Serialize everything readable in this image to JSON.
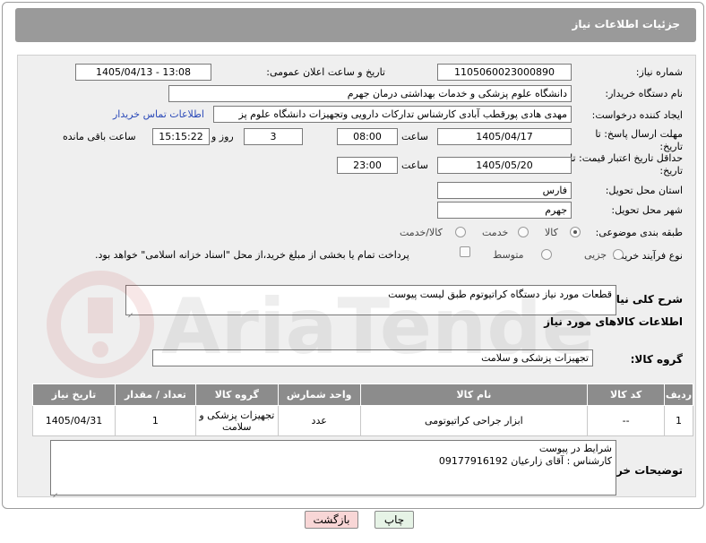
{
  "header": {
    "title": "جزئیات اطلاعات نیاز"
  },
  "fields": {
    "need_number_label": "شماره نیاز:",
    "need_number": "1105060023000890",
    "announce_label": "تاریخ و ساعت اعلان عمومی:",
    "announce_value": "1405/04/13 - 13:08",
    "buyer_label": "نام دستگاه خریدار:",
    "buyer_value": "دانشگاه علوم پزشکی و خدمات بهداشتی  درمان جهرم",
    "creator_label": "ایجاد کننده درخواست:",
    "creator_value": "مهدی هادی پورقطب آبادی کارشناس تدارکات دارویی وتجهیزات دانشگاه علوم پز",
    "contact_link": "اطلاعات تماس خریدار",
    "deadline_label": "مهلت ارسال پاسخ: تا تاریخ:",
    "deadline_date": "1405/04/17",
    "time_label": "ساعت",
    "deadline_time": "08:00",
    "days": "3",
    "days_label": "روز و",
    "remaining": "15:15:22",
    "remaining_label": "ساعت باقی مانده",
    "price_label": "حداقل تاریخ اعتبار قیمت: تا تاریخ:",
    "price_date": "1405/05/20",
    "price_time": "23:00",
    "province_label": "استان محل تحویل:",
    "province": "فارس",
    "city_label": "شهر محل تحویل:",
    "city": "جهرم",
    "category_label": "طبقه بندی موضوعی:",
    "category_options": [
      "کالا",
      "خدمت",
      "کالا/خدمت"
    ],
    "process_label": "نوع فرآیند خرید :",
    "process_options": [
      "جزیی",
      "متوسط"
    ],
    "payment_note": "پرداخت تمام یا بخشی از مبلغ خرید،از محل \"اسناد خزانه اسلامی\" خواهد بود.",
    "desc_label": "شرح کلی نیاز:",
    "desc_value": "قطعات مورد نیاز دستگاه کراتیوتوم طبق لیست پیوست",
    "goods_info_title": "اطلاعات کالاهای مورد نیاز",
    "goods_group_label": "گروه کالا:",
    "goods_group": "تجهیزات پزشکی و سلامت",
    "buyer_notes_label": "توضیحات خریدار:",
    "buyer_notes_line1": "شرایط در پیوست",
    "buyer_notes_line2": "کارشناس : آقای زارعیان 09177916192"
  },
  "table": {
    "headers": [
      "ردیف",
      "کد کالا",
      "نام کالا",
      "واحد شمارش",
      "گروه کالا",
      "تعداد / مقدار",
      "تاریخ نیاز"
    ],
    "rows": [
      [
        "1",
        "--",
        "ابزار جراحی کراتیوتومی",
        "عدد",
        "تجهیزات پزشکی و سلامت",
        "1",
        "1405/04/31"
      ]
    ]
  },
  "buttons": {
    "print": "چاپ",
    "back": "بازگشت"
  },
  "watermark": "AriaTender.net",
  "colors": {
    "header_bg": "#9a9a9a",
    "panel_bg": "#efefef",
    "table_header": "#8c8c8c",
    "back_btn": "#f8d6d6",
    "link": "#2a49b8"
  }
}
